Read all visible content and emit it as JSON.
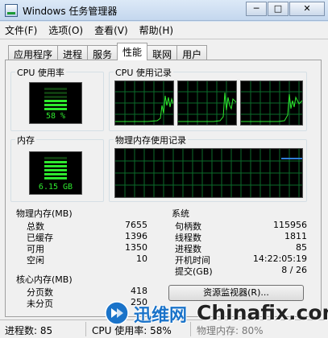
{
  "window": {
    "title": "Windows 任务管理器",
    "minimize": "─",
    "maximize": "□",
    "close": "✕"
  },
  "menu": [
    "文件(F)",
    "选项(O)",
    "查看(V)",
    "帮助(H)"
  ],
  "tabs": [
    {
      "label": "应用程序",
      "active": false
    },
    {
      "label": "进程",
      "active": false
    },
    {
      "label": "服务",
      "active": false
    },
    {
      "label": "性能",
      "active": true
    },
    {
      "label": "联网",
      "active": false
    },
    {
      "label": "用户",
      "active": false
    }
  ],
  "cpu_usage": {
    "title": "CPU 使用率",
    "value": "58 %",
    "level": 0.58
  },
  "cpu_history": {
    "title": "CPU 使用记录"
  },
  "memory": {
    "title": "内存",
    "value": "6.15 GB",
    "level": 0.8
  },
  "memory_history": {
    "title": "物理内存使用记录",
    "level": 0.8
  },
  "physical_memory": {
    "title": "物理内存(MB)",
    "rows": [
      {
        "label": "总数",
        "value": "7655"
      },
      {
        "label": "已缓存",
        "value": "1396"
      },
      {
        "label": "可用",
        "value": "1350"
      },
      {
        "label": "空闲",
        "value": "10"
      }
    ]
  },
  "system": {
    "title": "系统",
    "rows": [
      {
        "label": "句柄数",
        "value": "115956"
      },
      {
        "label": "线程数",
        "value": "1811"
      },
      {
        "label": "进程数",
        "value": "85"
      },
      {
        "label": "开机时间",
        "value": "14:22:05:19"
      },
      {
        "label": "提交(GB)",
        "value": "8 / 26"
      }
    ]
  },
  "kernel_memory": {
    "title": "核心内存(MB)",
    "rows": [
      {
        "label": "分页数",
        "value": "418"
      },
      {
        "label": "未分页",
        "value": "250"
      }
    ]
  },
  "resource_monitor_label": "资源监视器(R)...",
  "statusbar": {
    "processes": "进程数: 85",
    "cpu": "CPU 使用率: 58%",
    "memory": "物理内存: 80%"
  },
  "watermarks": {
    "xunwei": "迅维网",
    "chinafix": "Chinafix.com"
  },
  "colors": {
    "graph_green": "#2ee82e",
    "graph_grid": "#0b6b2a",
    "memory_line": "#2f7dd8",
    "accent": "#1a73c9"
  }
}
